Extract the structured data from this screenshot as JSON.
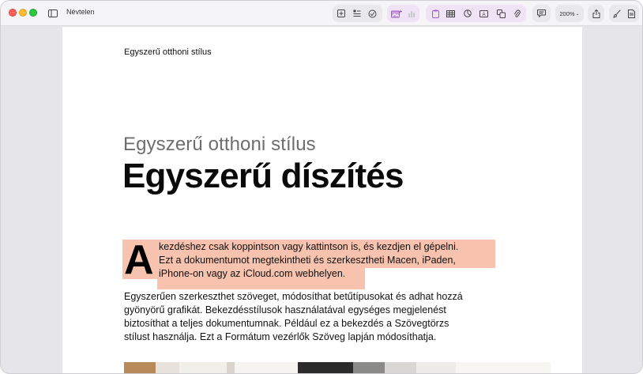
{
  "window": {
    "title": "Névtelen"
  },
  "toolbar": {
    "buttons": [
      {
        "name": "sidebar-toggle",
        "icon": "sidebar-icon"
      },
      {
        "name": "add-page",
        "icon": "plus-square-icon"
      },
      {
        "name": "paragraph-style",
        "icon": "list-icon"
      },
      {
        "name": "insert-media",
        "icon": "photo-plus-icon"
      },
      {
        "name": "insert-chart-disabled",
        "icon": "chart-icon"
      },
      {
        "name": "insert-shape",
        "icon": "clipboard-icon"
      },
      {
        "name": "insert-table",
        "icon": "table-icon"
      },
      {
        "name": "insert-chart",
        "icon": "pie-icon"
      },
      {
        "name": "insert-textbox",
        "icon": "textbox-icon"
      },
      {
        "name": "insert-shape-2",
        "icon": "shapes-icon"
      },
      {
        "name": "attachment",
        "icon": "paperclip-icon"
      },
      {
        "name": "comment",
        "icon": "comment-icon"
      },
      {
        "name": "share",
        "icon": "share-icon"
      },
      {
        "name": "format",
        "icon": "paintbrush-icon"
      },
      {
        "name": "document",
        "icon": "document-icon"
      }
    ],
    "zoom": "200%"
  },
  "page": {
    "running_head": "Egyszerű otthoni stílus",
    "subtitle": "Egyszerű otthoni stílus",
    "title": "Egyszerű díszítés",
    "dropcap": "A",
    "intro_lines": [
      "kezdéshez csak koppintson vagy kattintson is, és kezdjen el gépelni.",
      "Ezt a dokumentumot megtekintheti és szerkesztheti Macen, iPaden,",
      "iPhone-on vagy az iCloud.com webhelyen."
    ],
    "body_lines": [
      "Egyszerűen szerkeszthet szöveget, módosíthat betűtípusokat és adhat hozzá",
      "gyönyörű grafikát. Bekezdésstílusok használatával egységes megjelenést",
      "biztosíthat a teljes dokumentumnak. Például ez a bekezdés a Szövegtörzs",
      "stílust használja. Ezt a Formátum vezérlők Szöveg lapján módosíthatja."
    ]
  },
  "colors": {
    "selection": "#f7c2ae",
    "background": "#e6e6ea",
    "page": "#ffffff"
  }
}
